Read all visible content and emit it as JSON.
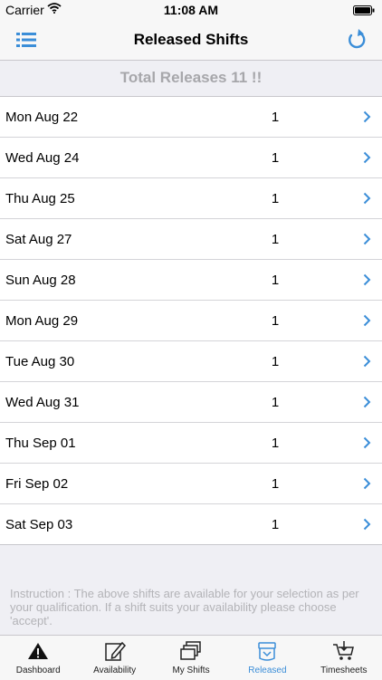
{
  "status_bar": {
    "carrier": "Carrier",
    "time": "11:08 AM"
  },
  "nav": {
    "title": "Released Shifts"
  },
  "summary": {
    "text": "Total Releases 11 !!"
  },
  "shifts": [
    {
      "date": "Mon Aug 22",
      "count": "1"
    },
    {
      "date": "Wed Aug 24",
      "count": "1"
    },
    {
      "date": "Thu Aug 25",
      "count": "1"
    },
    {
      "date": "Sat Aug 27",
      "count": "1"
    },
    {
      "date": "Sun Aug 28",
      "count": "1"
    },
    {
      "date": "Mon Aug 29",
      "count": "1"
    },
    {
      "date": "Tue Aug 30",
      "count": "1"
    },
    {
      "date": "Wed Aug 31",
      "count": "1"
    },
    {
      "date": "Thu Sep 01",
      "count": "1"
    },
    {
      "date": "Fri Sep 02",
      "count": "1"
    },
    {
      "date": "Sat Sep 03",
      "count": "1"
    }
  ],
  "instruction": "Instruction : The above shifts are available for your selection as per your qualification. If a shift suits your availability please choose 'accept'.",
  "tabs": [
    {
      "label": "Dashboard",
      "icon": "warning-icon"
    },
    {
      "label": "Availability",
      "icon": "edit-icon"
    },
    {
      "label": "My Shifts",
      "icon": "stack-icon"
    },
    {
      "label": "Released",
      "icon": "released-icon",
      "active": true
    },
    {
      "label": "Timesheets",
      "icon": "cart-icon"
    }
  ],
  "colors": {
    "accent": "#3b8ed8",
    "muted": "#a7a7ab",
    "background": "#efeff4"
  }
}
